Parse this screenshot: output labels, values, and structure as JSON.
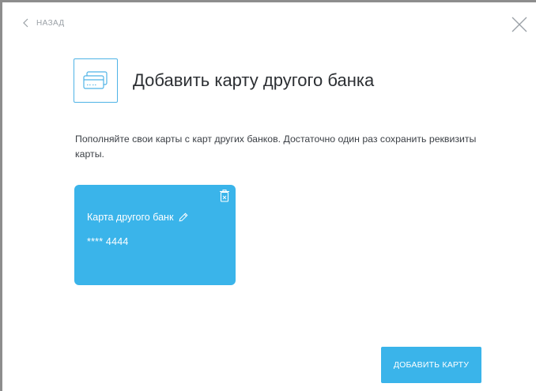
{
  "nav": {
    "back_label": "НАЗАД"
  },
  "header": {
    "title": "Добавить карту другого банка"
  },
  "description": "Пополняйте свои карты с карт других банков. Достаточно один раз сохранить реквизиты карты.",
  "saved_card": {
    "name": "Карта другого банк",
    "masked_number": "**** 4444"
  },
  "actions": {
    "add_card_label": "ДОБАВИТЬ КАРТУ"
  },
  "colors": {
    "accent": "#3ab4ea",
    "icon_border": "#4fb3e6",
    "text": "#2c2f33"
  },
  "icons": [
    "chevron-left-icon",
    "close-icon",
    "credit-card-icon",
    "trash-icon",
    "pencil-icon"
  ]
}
